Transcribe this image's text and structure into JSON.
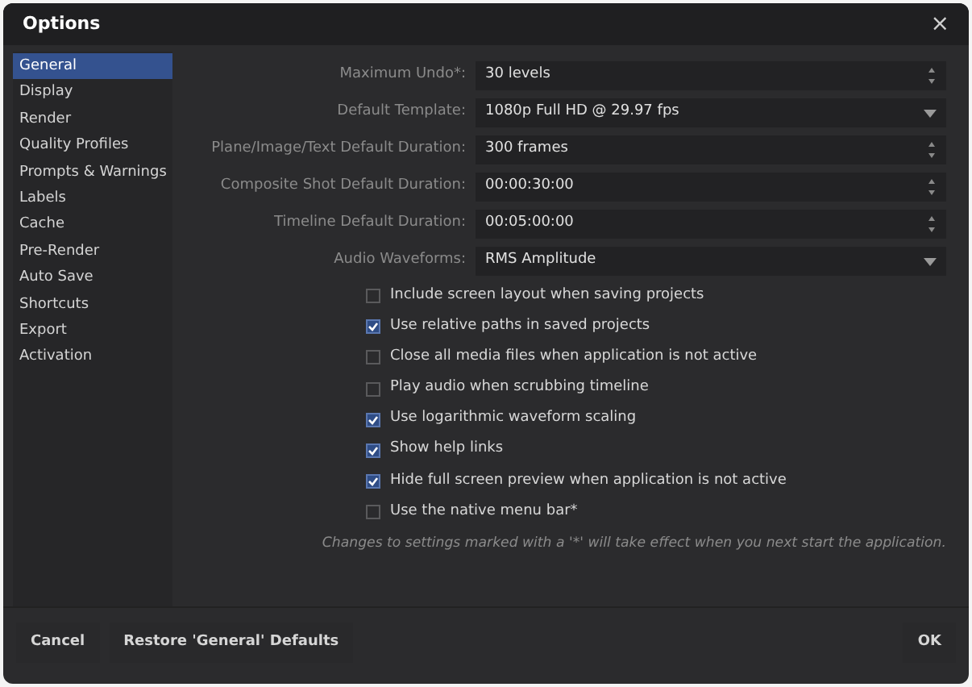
{
  "window": {
    "title": "Options",
    "close": "×"
  },
  "sidebar": {
    "items": [
      {
        "label": "General",
        "selected": true
      },
      {
        "label": "Display",
        "selected": false
      },
      {
        "label": "Render",
        "selected": false
      },
      {
        "label": "Quality Profiles",
        "selected": false
      },
      {
        "label": "Prompts & Warnings",
        "selected": false
      },
      {
        "label": "Labels",
        "selected": false
      },
      {
        "label": "Cache",
        "selected": false
      },
      {
        "label": "Pre-Render",
        "selected": false
      },
      {
        "label": "Auto Save",
        "selected": false
      },
      {
        "label": "Shortcuts",
        "selected": false
      },
      {
        "label": "Export",
        "selected": false
      },
      {
        "label": "Activation",
        "selected": false
      }
    ]
  },
  "fields": [
    {
      "label": "Maximum Undo*:",
      "value": "30 levels",
      "kind": "spin"
    },
    {
      "label": "Default Template:",
      "value": "1080p Full HD @ 29.97 fps",
      "kind": "dropdown"
    },
    {
      "label": "Plane/Image/Text Default Duration:",
      "value": "300 frames",
      "kind": "spin"
    },
    {
      "label": "Composite Shot Default Duration:",
      "value": "00:00:30:00",
      "kind": "spin"
    },
    {
      "label": "Timeline Default Duration:",
      "value": "00:05:00:00",
      "kind": "spin"
    },
    {
      "label": "Audio Waveforms:",
      "value": "RMS Amplitude",
      "kind": "dropdown"
    }
  ],
  "checkboxes": [
    {
      "label": "Include screen layout when saving projects",
      "checked": false
    },
    {
      "label": "Use relative paths in saved projects",
      "checked": true
    },
    {
      "label": "Close all media files when application is not active",
      "checked": false
    },
    {
      "label": "Play audio when scrubbing timeline",
      "checked": false
    },
    {
      "label": "Use logarithmic waveform scaling",
      "checked": true
    },
    {
      "label": "Show help links",
      "checked": true
    },
    {
      "label": "Hide full screen preview when application is not active",
      "checked": true
    },
    {
      "label": "Use the native menu bar*",
      "checked": false
    }
  ],
  "note": "Changes to settings marked with a '*' will take effect when you next start the application.",
  "buttons": {
    "left": [
      "Cancel",
      "Restore 'General' Defaults"
    ],
    "right": [
      "OK"
    ]
  }
}
